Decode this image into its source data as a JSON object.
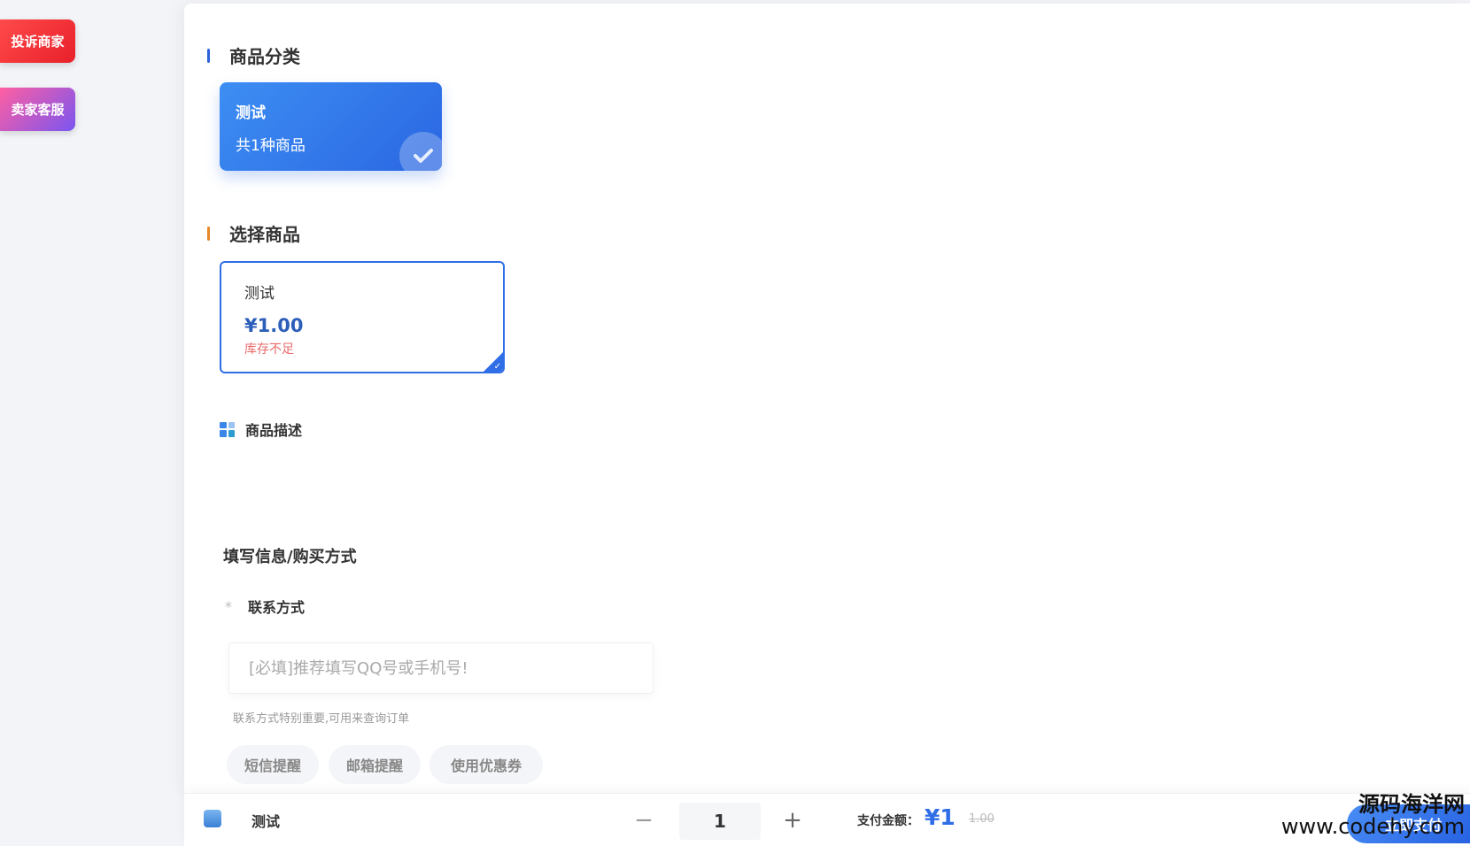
{
  "side_buttons": {
    "complain": "投诉商家",
    "service": "卖家客服"
  },
  "category": {
    "title": "商品分类",
    "card": {
      "name": "测试",
      "count": "共1种商品"
    }
  },
  "product": {
    "title": "选择商品",
    "card": {
      "name": "测试",
      "price": "¥1.00",
      "stock": "库存不足"
    }
  },
  "description": {
    "title": "商品描述"
  },
  "form": {
    "title": "填写信息/购买方式",
    "contact_label": "联系方式",
    "required_mark": "*",
    "contact_placeholder": "[必填]推荐填写QQ号或手机号!",
    "contact_value": "",
    "contact_hint": "联系方式特别重要,可用来查询订单",
    "options": [
      "短信提醒",
      "邮箱提醒",
      "使用优惠券"
    ]
  },
  "bottom_bar": {
    "product_name": "测试",
    "minus": "−",
    "quantity": "1",
    "plus": "+",
    "pay_label": "支付金额：",
    "pay_amount": "¥1",
    "original_price": "1.00",
    "pay_button": "立即支付"
  },
  "watermark": {
    "line1": "源码海洋网",
    "line2": "www.codehy.com"
  },
  "colors": {
    "accent": "#2f6ee6",
    "complain": "#e8202a",
    "service": "#7a55f0",
    "stock_warning": "#e96a6a"
  }
}
